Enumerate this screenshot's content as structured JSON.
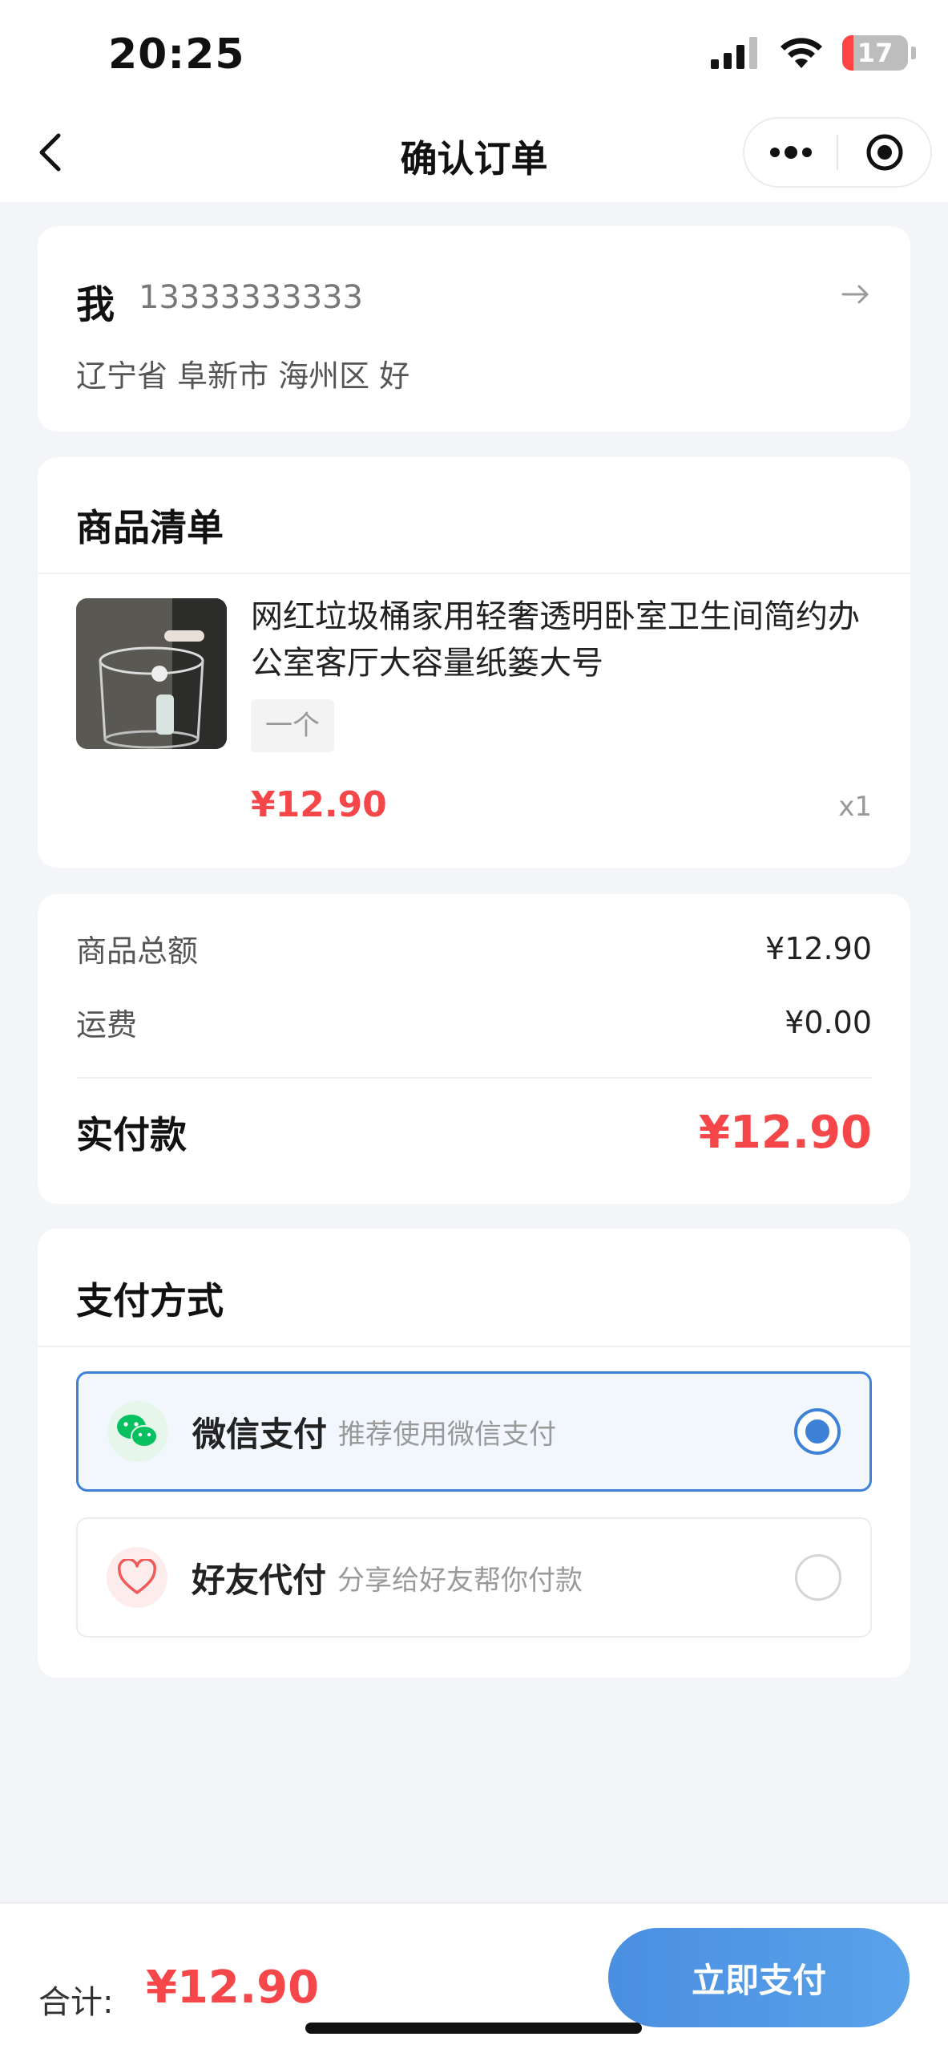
{
  "status_bar": {
    "time": "20:25",
    "battery_level": "17"
  },
  "nav": {
    "title": "确认订单",
    "back_icon": "chevron-left-icon",
    "more_icon": "more-dots-icon",
    "close_icon": "target-circle-icon"
  },
  "address": {
    "name": "我",
    "phone": "13333333333",
    "detail": "辽宁省 阜新市 海州区 好"
  },
  "goods": {
    "section_title": "商品清单",
    "items": [
      {
        "name": "网红垃圾桶家用轻奢透明卧室卫生间简约办公室客厅大容量纸篓大号",
        "spec": "一个",
        "price": "¥12.90",
        "qty": "x1"
      }
    ]
  },
  "summary": {
    "goods_total_label": "商品总额",
    "goods_total_value": "¥12.90",
    "shipping_label": "运费",
    "shipping_value": "¥0.00",
    "paid_label": "实付款",
    "paid_value": "¥12.90"
  },
  "payment": {
    "section_title": "支付方式",
    "options": [
      {
        "name": "微信支付",
        "desc": "推荐使用微信支付",
        "selected": true
      },
      {
        "name": "好友代付",
        "desc": "分享给好友帮你付款",
        "selected": false
      }
    ]
  },
  "footer": {
    "total_label": "合计:",
    "total_value": "¥12.90",
    "pay_button": "立即支付"
  },
  "colors": {
    "accent_blue": "#3d82d6",
    "price_red": "#f5474a",
    "wechat_green": "#07c160"
  }
}
